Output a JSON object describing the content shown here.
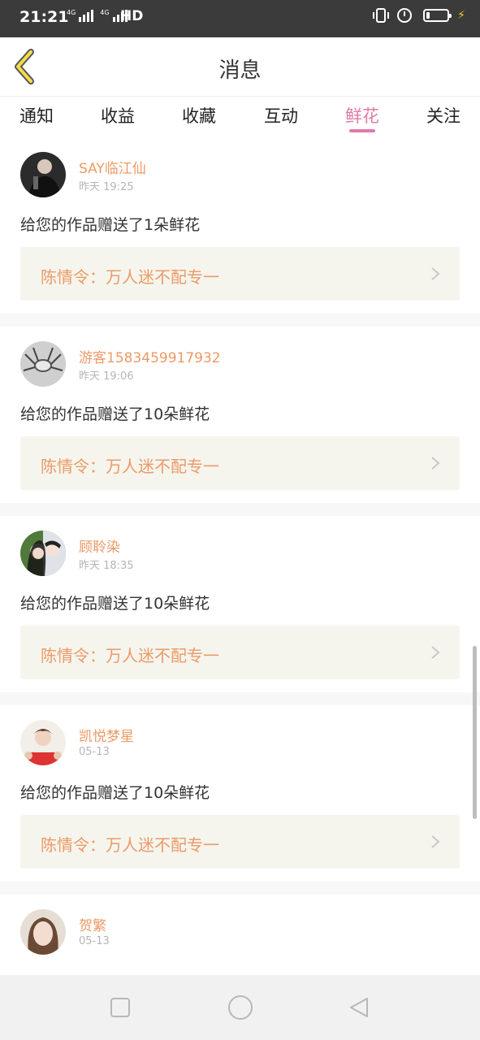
{
  "status_bar": {
    "time": "21:21",
    "network_label": "4G",
    "network_label2": "4G",
    "hd_label": "HD"
  },
  "header": {
    "title": "消息"
  },
  "tabs": [
    {
      "label": "通知",
      "active": false
    },
    {
      "label": "收益",
      "active": false
    },
    {
      "label": "收藏",
      "active": false
    },
    {
      "label": "互动",
      "active": false
    },
    {
      "label": "鲜花",
      "active": true
    },
    {
      "label": "关注",
      "active": false
    }
  ],
  "feed": [
    {
      "user": "SAY临江仙",
      "time": "昨天 19:25",
      "message": "给您的作品赠送了1朵鲜花",
      "work": "陈情令：万人迷不配专一"
    },
    {
      "user": "游客1583459917932",
      "time": "昨天 19:06",
      "message": "给您的作品赠送了10朵鲜花",
      "work": "陈情令：万人迷不配专一"
    },
    {
      "user": "顾聆染",
      "time": "昨天 18:35",
      "message": "给您的作品赠送了10朵鲜花",
      "work": "陈情令：万人迷不配专一"
    },
    {
      "user": "凯悦梦星",
      "time": "05-13",
      "message": "给您的作品赠送了10朵鲜花",
      "work": "陈情令：万人迷不配专一"
    },
    {
      "user": "贺繁",
      "time": "05-13",
      "message": "",
      "work": ""
    }
  ],
  "colors": {
    "accent_pink": "#e07aa8",
    "accent_orange": "#ec9a66",
    "back_arrow": "#f3dc4a"
  }
}
